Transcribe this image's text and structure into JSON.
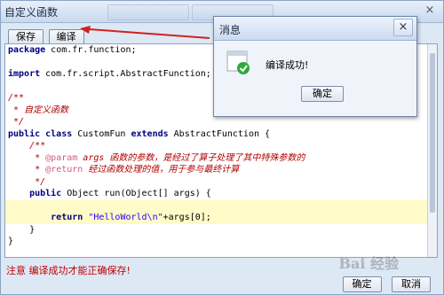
{
  "window": {
    "title": "自定义函数",
    "close_glyph": "×"
  },
  "toolbar": {
    "save_label": "保存",
    "compile_label": "编译"
  },
  "code_lines": [
    [
      {
        "t": "package",
        "c": "kw"
      },
      {
        "t": " com.fr.function;"
      }
    ],
    [],
    [
      {
        "t": "import",
        "c": "kw"
      },
      {
        "t": " com.fr.script.AbstractFunction;"
      }
    ],
    [],
    [
      {
        "t": "/**",
        "c": "cm"
      }
    ],
    [
      {
        "t": " * 自定义函数",
        "c": "cm"
      }
    ],
    [
      {
        "t": " */",
        "c": "cm"
      }
    ],
    [
      {
        "t": "public class",
        "c": "kw"
      },
      {
        "t": " CustomFun "
      },
      {
        "t": "extends",
        "c": "kw"
      },
      {
        "t": " AbstractFunction {"
      }
    ],
    [
      {
        "t": "    /**",
        "c": "cm"
      }
    ],
    [
      {
        "t": "     * ",
        "c": "cm"
      },
      {
        "t": "@param",
        "c": "tag"
      },
      {
        "t": " args 函数的参数，是经过了算子处理了其中特殊参数的",
        "c": "cm"
      }
    ],
    [
      {
        "t": "     * ",
        "c": "cm"
      },
      {
        "t": "@return",
        "c": "tag"
      },
      {
        "t": " 经过函数处理的值，用于参与最终计算",
        "c": "cm"
      }
    ],
    [
      {
        "t": "     */",
        "c": "cm"
      }
    ],
    [
      {
        "t": "    public",
        "c": "kw"
      },
      {
        "t": " Object run(Object[] args) {"
      }
    ],
    [],
    [
      {
        "t": "        return",
        "c": "kw"
      },
      {
        "t": " "
      },
      {
        "t": "\"HelloWorld\\n\"",
        "c": "str"
      },
      {
        "t": "+args[0];"
      }
    ],
    [
      {
        "t": "    }"
      }
    ],
    [
      {
        "t": "}"
      }
    ]
  ],
  "highlighted_lines": [
    13,
    14
  ],
  "footer": {
    "note": "注意 编译成功才能正确保存!",
    "ok_label": "确定",
    "cancel_label": "取消"
  },
  "dialog": {
    "title": "消息",
    "message": "编译成功!",
    "ok_label": "确定",
    "icon": "success-check-icon",
    "close_glyph": "×"
  },
  "watermark": "Bai 经验",
  "colors": {
    "arrow": "#d22020",
    "success": "#2eaa3c"
  }
}
